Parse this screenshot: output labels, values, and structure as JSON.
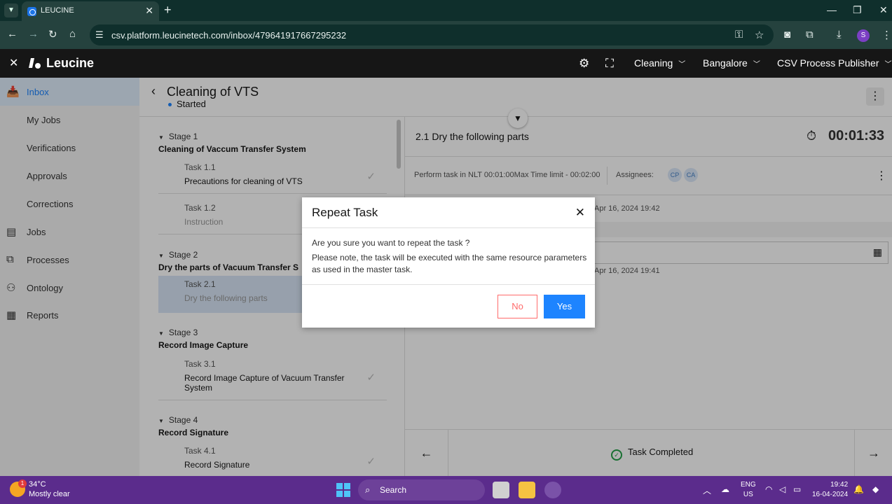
{
  "browser": {
    "tab_title": "LEUCINE",
    "url": "csv.platform.leucinetech.com/inbox/479641917667295232",
    "profile_initial": "S"
  },
  "app": {
    "brand": "Leucine",
    "facility": "Cleaning",
    "location": "Bangalore",
    "role": "CSV Process Publisher"
  },
  "sidebar": {
    "items": [
      {
        "label": "Inbox"
      },
      {
        "label": "My Jobs"
      },
      {
        "label": "Verifications"
      },
      {
        "label": "Approvals"
      },
      {
        "label": "Corrections"
      },
      {
        "label": "Jobs"
      },
      {
        "label": "Processes"
      },
      {
        "label": "Ontology"
      },
      {
        "label": "Reports"
      }
    ]
  },
  "checklist": {
    "title": "Cleaning of VTS",
    "status": "Started",
    "stages": [
      {
        "num": "Stage 1",
        "name": "Cleaning of Vaccum Transfer System",
        "tasks": [
          {
            "num": "Task 1.1",
            "name": "Precautions for cleaning of VTS"
          },
          {
            "num": "Task 1.2",
            "name": "Instruction"
          }
        ]
      },
      {
        "num": "Stage 2",
        "name": "Dry the parts of Vacuum Transfer S",
        "tasks": [
          {
            "num": "Task 2.1",
            "name": "Dry the following parts"
          }
        ]
      },
      {
        "num": "Stage 3",
        "name": "Record Image Capture",
        "tasks": [
          {
            "num": "Task 3.1",
            "name": "Record Image Capture of Vacuum Transfer System"
          }
        ]
      },
      {
        "num": "Stage 4",
        "name": "Record Signature",
        "tasks": [
          {
            "num": "Task 4.1",
            "name": "Record Signature"
          }
        ]
      }
    ]
  },
  "task": {
    "heading": "2.1 Dry the following parts",
    "timer": "00:01:33",
    "timing_text": "Perform task in NLT 00:01:00Max Time limit - 00:02:00",
    "assignees_label": "Assignees:",
    "assignees": [
      "CP",
      "CA"
    ],
    "date_1": "Apr 16, 2024 19:42",
    "date_2": "Apr 16, 2024 19:41",
    "footer_status": "Task Completed"
  },
  "modal": {
    "title": "Repeat Task",
    "question": "Are you sure you want to repeat the task ?",
    "note": "Please note, the task will be executed with the same resource parameters as used in the master task.",
    "no_label": "No",
    "yes_label": "Yes"
  },
  "taskbar": {
    "temperature": "34°C",
    "condition": "Mostly clear",
    "weather_badge": "1",
    "search_label": "Search",
    "lang_1": "ENG",
    "lang_2": "US",
    "time": "19:42",
    "date": "16-04-2024"
  },
  "colors": {
    "accent": "#1d84ff",
    "danger": "#ff6b6b",
    "success": "#24a148",
    "taskbar": "#5b2c8c",
    "browser": "#25423e"
  }
}
